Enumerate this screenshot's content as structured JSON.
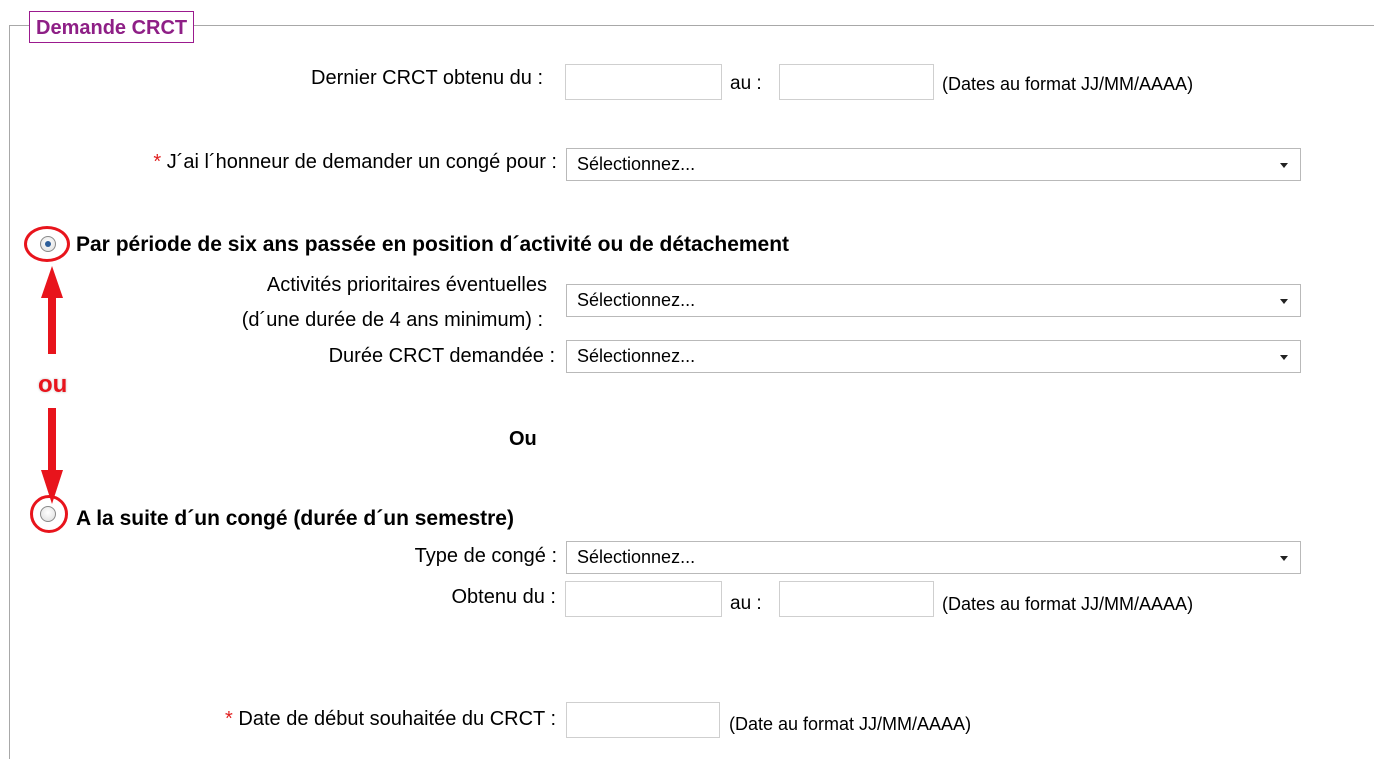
{
  "legend": "Demande CRCT",
  "row_dernier": {
    "label": "Dernier CRCT obtenu du :",
    "au": "au :",
    "hint": "(Dates au format JJ/MM/AAAA)",
    "from_value": "",
    "to_value": ""
  },
  "row_honneur": {
    "required_mark": "*",
    "label": "J´ai l´honneur de demander un congé pour :",
    "selected": "Sélectionnez..."
  },
  "option1": {
    "heading": "Par période de six ans passée en position d´activité ou de détachement",
    "checked": true,
    "activites_label_line1": "Activités prioritaires éventuelles",
    "activites_label_line2": "(d´une durée de 4 ans minimum) :",
    "activites_selected": "Sélectionnez...",
    "duree_label": "Durée CRCT demandée :",
    "duree_selected": "Sélectionnez..."
  },
  "separator": "Ou",
  "annotation": {
    "text": "ou",
    "color": "#e8141c"
  },
  "option2": {
    "heading": "A la suite d´un congé (durée d´un semestre)",
    "checked": false,
    "type_label": "Type de congé :",
    "type_selected": "Sélectionnez...",
    "obtenu_label": "Obtenu du :",
    "au": "au :",
    "hint": "(Dates au format JJ/MM/AAAA)",
    "from_value": "",
    "to_value": ""
  },
  "row_date_debut": {
    "required_mark": "*",
    "label": "Date de début souhaitée du CRCT :",
    "hint": "(Date au format JJ/MM/AAAA)",
    "value": ""
  },
  "colors": {
    "legend": "#8e1f86",
    "required": "#e02020",
    "annotation": "#e8141c"
  }
}
